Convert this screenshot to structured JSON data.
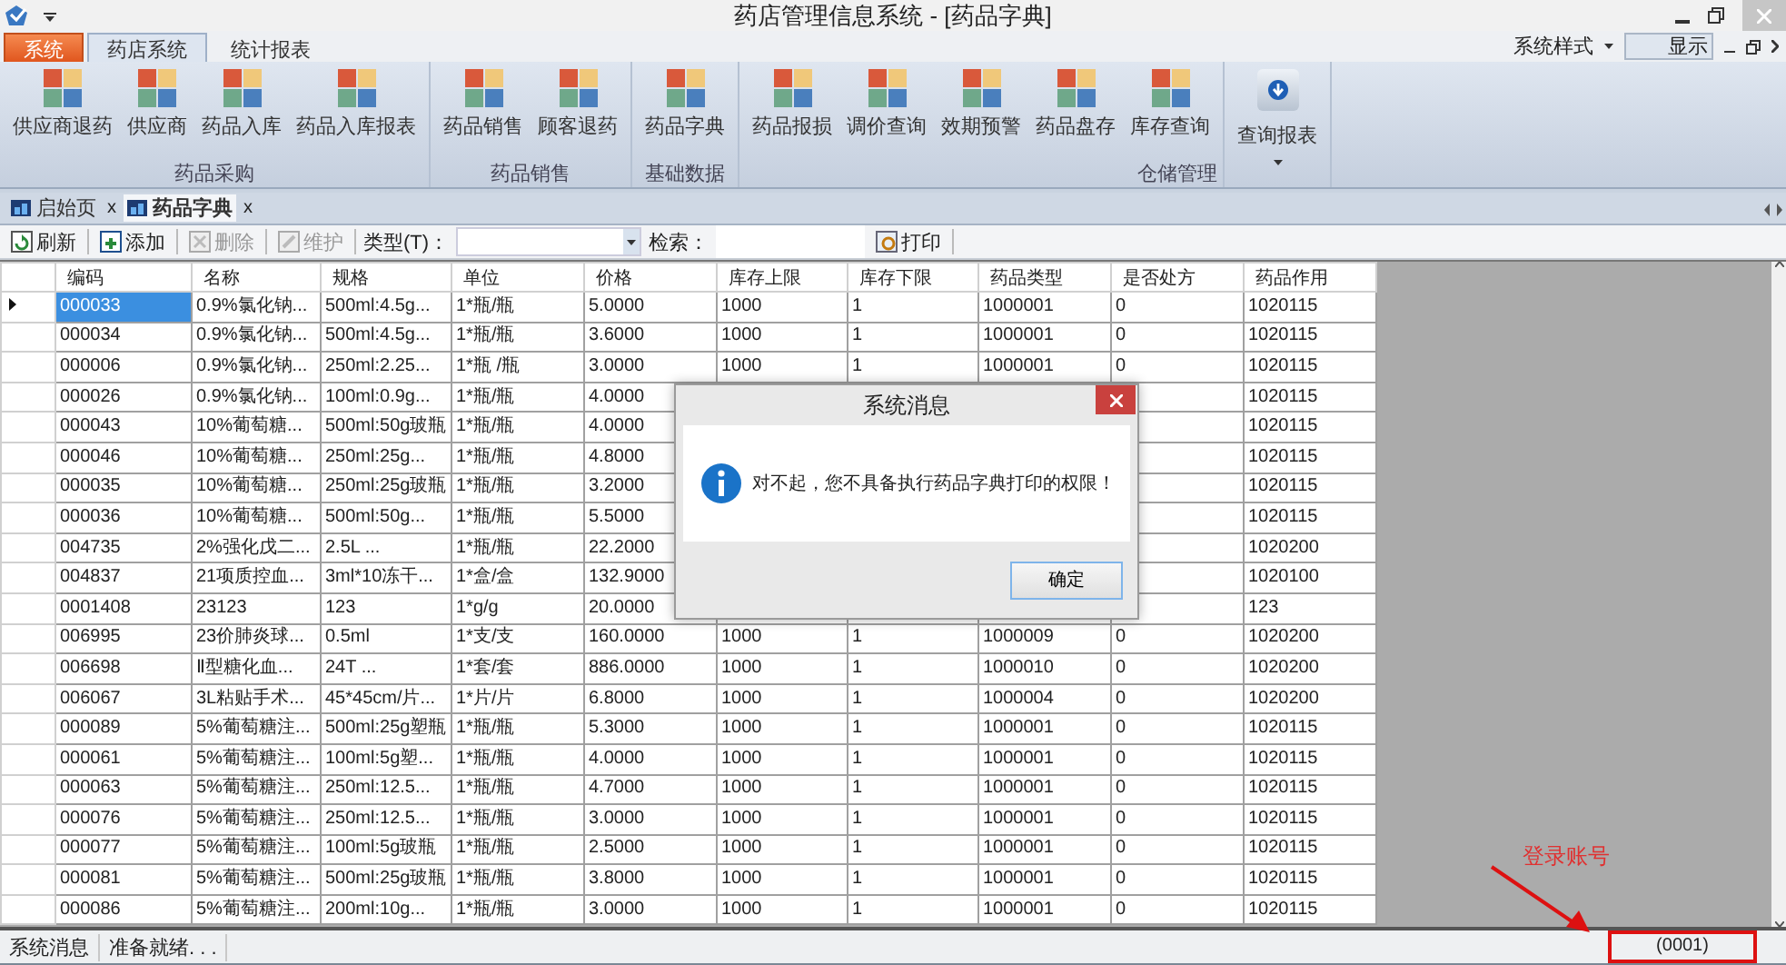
{
  "window": {
    "title": "药店管理信息系统 - [药品字典]"
  },
  "ribbon_tabs": [
    {
      "label": "系统",
      "kind": "app",
      "selected": false
    },
    {
      "label": "药店系统",
      "kind": "tab",
      "selected": true
    },
    {
      "label": "统计报表",
      "kind": "tab",
      "selected": false
    }
  ],
  "style_menu": {
    "label": "系统样式",
    "value": "显示"
  },
  "ribbon_groups": [
    {
      "label": "药品采购",
      "buttons": [
        {
          "label": "供应商退药",
          "kind": "large"
        },
        {
          "label": "供应商",
          "kind": "large"
        },
        {
          "label": "药品入库",
          "kind": "large"
        },
        {
          "label": "药品入库报表",
          "kind": "large"
        }
      ]
    },
    {
      "label": "药品销售",
      "buttons": [
        {
          "label": "药品销售",
          "kind": "large"
        },
        {
          "label": "顾客退药",
          "kind": "large"
        }
      ]
    },
    {
      "label": "基础数据",
      "buttons": [
        {
          "label": "药品字典",
          "kind": "large"
        }
      ]
    },
    {
      "label": "仓储管理",
      "buttons": [
        {
          "label": "药品报损",
          "kind": "large"
        },
        {
          "label": "调价查询",
          "kind": "large"
        },
        {
          "label": "效期预警",
          "kind": "large"
        },
        {
          "label": "药品盘存",
          "kind": "large"
        },
        {
          "label": "库存查询",
          "kind": "large"
        }
      ]
    },
    {
      "buttons": [
        {
          "label": "查询报表",
          "kind": "dropdown"
        }
      ]
    }
  ],
  "doc_tabs": [
    {
      "label": "启始页",
      "close": "x",
      "selected": false
    },
    {
      "label": "药品字典",
      "close": "x",
      "selected": true
    }
  ],
  "toolbar": [
    {
      "kind": "button",
      "label": "刷新",
      "disabled": false
    },
    {
      "kind": "button",
      "label": "添加",
      "disabled": false
    },
    {
      "kind": "button",
      "label": "删除",
      "disabled": true
    },
    {
      "kind": "button",
      "label": "维护",
      "disabled": true
    },
    {
      "kind": "combo",
      "label": "类型(T)："
    },
    {
      "kind": "search",
      "label": "检索："
    },
    {
      "kind": "button",
      "label": "打印",
      "disabled": false
    }
  ],
  "table": {
    "columns": [
      "编码",
      "名称",
      "规格",
      "单位",
      "价格",
      "库存上限",
      "库存下限",
      "药品类型",
      "是否处方",
      "药品作用"
    ],
    "rows": [
      {
        "selected": true,
        "cells": [
          "000033",
          "0.9%氯化钠...",
          "500ml:4.5g...",
          "1*瓶/瓶",
          "5.0000",
          "1000",
          "1",
          "1000001",
          "0",
          "1020115"
        ]
      },
      {
        "selected": false,
        "cells": [
          "000034",
          "0.9%氯化钠...",
          "500ml:4.5g...",
          "1*瓶/瓶",
          "3.6000",
          "1000",
          "1",
          "1000001",
          "0",
          "1020115"
        ]
      },
      {
        "selected": false,
        "cells": [
          "000006",
          "0.9%氯化钠...",
          "250ml:2.25...",
          "1*瓶 /瓶",
          "3.0000",
          "1000",
          "1",
          "1000001",
          "0",
          "1020115"
        ]
      },
      {
        "selected": false,
        "cells": [
          "000026",
          "0.9%氯化钠...",
          "100ml:0.9g...",
          "1*瓶/瓶",
          "4.0000",
          null,
          null,
          null,
          null,
          "1020115"
        ]
      },
      {
        "selected": false,
        "cells": [
          "000043",
          "10%葡萄糖...",
          "500ml:50g玻瓶",
          "1*瓶/瓶",
          "4.0000",
          null,
          null,
          null,
          null,
          "1020115"
        ]
      },
      {
        "selected": false,
        "cells": [
          "000046",
          "10%葡萄糖...",
          "250ml:25g...",
          "1*瓶/瓶",
          "4.8000",
          null,
          null,
          null,
          null,
          "1020115"
        ]
      },
      {
        "selected": false,
        "cells": [
          "000035",
          "10%葡萄糖...",
          "250ml:25g玻瓶",
          "1*瓶/瓶",
          "3.2000",
          null,
          null,
          null,
          null,
          "1020115"
        ]
      },
      {
        "selected": false,
        "cells": [
          "000036",
          "10%葡萄糖...",
          "500ml:50g...",
          "1*瓶/瓶",
          "5.5000",
          null,
          null,
          null,
          null,
          "1020115"
        ]
      },
      {
        "selected": false,
        "cells": [
          "004735",
          "2%强化戊二...",
          "2.5L ...",
          "1*瓶/瓶",
          "22.2000",
          null,
          null,
          null,
          null,
          "1020200"
        ]
      },
      {
        "selected": false,
        "cells": [
          "004837",
          "21项质控血...",
          "3ml*10冻干...",
          "1*盒/盒",
          "132.9000",
          null,
          null,
          null,
          null,
          "1020100"
        ]
      },
      {
        "selected": false,
        "cells": [
          "0001408",
          "23123",
          "123",
          "1*g/g",
          "20.0000",
          null,
          null,
          null,
          null,
          "123"
        ]
      },
      {
        "selected": false,
        "cells": [
          "006995",
          "23价肺炎球...",
          "0.5ml",
          "1*支/支",
          "160.0000",
          "1000",
          "1",
          "1000009",
          "0",
          "1020200"
        ]
      },
      {
        "selected": false,
        "cells": [
          "006698",
          "Ⅱ型糖化血...",
          "24T ...",
          "1*套/套",
          "886.0000",
          "1000",
          "1",
          "1000010",
          "0",
          "1020200"
        ]
      },
      {
        "selected": false,
        "cells": [
          "006067",
          "3L粘贴手术...",
          "45*45cm/片...",
          "1*片/片",
          "6.8000",
          "1000",
          "1",
          "1000004",
          "0",
          "1020200"
        ]
      },
      {
        "selected": false,
        "cells": [
          "000089",
          "5%葡萄糖注...",
          "500ml:25g塑瓶",
          "1*瓶/瓶",
          "5.3000",
          "1000",
          "1",
          "1000001",
          "0",
          "1020115"
        ]
      },
      {
        "selected": false,
        "cells": [
          "000061",
          "5%葡萄糖注...",
          "100ml:5g塑...",
          "1*瓶/瓶",
          "4.0000",
          "1000",
          "1",
          "1000001",
          "0",
          "1020115"
        ]
      },
      {
        "selected": false,
        "cells": [
          "000063",
          "5%葡萄糖注...",
          "250ml:12.5...",
          "1*瓶/瓶",
          "4.7000",
          "1000",
          "1",
          "1000001",
          "0",
          "1020115"
        ]
      },
      {
        "selected": false,
        "cells": [
          "000076",
          "5%葡萄糖注...",
          "250ml:12.5...",
          "1*瓶/瓶",
          "3.0000",
          "1000",
          "1",
          "1000001",
          "0",
          "1020115"
        ]
      },
      {
        "selected": false,
        "cells": [
          "000077",
          "5%葡萄糖注...",
          "100ml:5g玻瓶",
          "1*瓶/瓶",
          "2.5000",
          "1000",
          "1",
          "1000001",
          "0",
          "1020115"
        ]
      },
      {
        "selected": false,
        "cells": [
          "000081",
          "5%葡萄糖注...",
          "500ml:25g玻瓶",
          "1*瓶/瓶",
          "3.8000",
          "1000",
          "1",
          "1000001",
          "0",
          "1020115"
        ]
      },
      {
        "selected": false,
        "cells": [
          "000086",
          "5%葡萄糖注...",
          "200ml:10g...",
          "1*瓶/瓶",
          "3.0000",
          "1000",
          "1",
          "1000001",
          "0",
          "1020115"
        ]
      }
    ]
  },
  "status_bar": {
    "items": [
      "系统消息",
      "准备就绪. . ."
    ],
    "account": "(0001)"
  },
  "dialog": {
    "title": "系统消息",
    "message": "对不起，您不具备执行药品字典打印的权限！",
    "buttons": [
      "确定"
    ]
  },
  "annotation": {
    "label": "登录账号"
  }
}
